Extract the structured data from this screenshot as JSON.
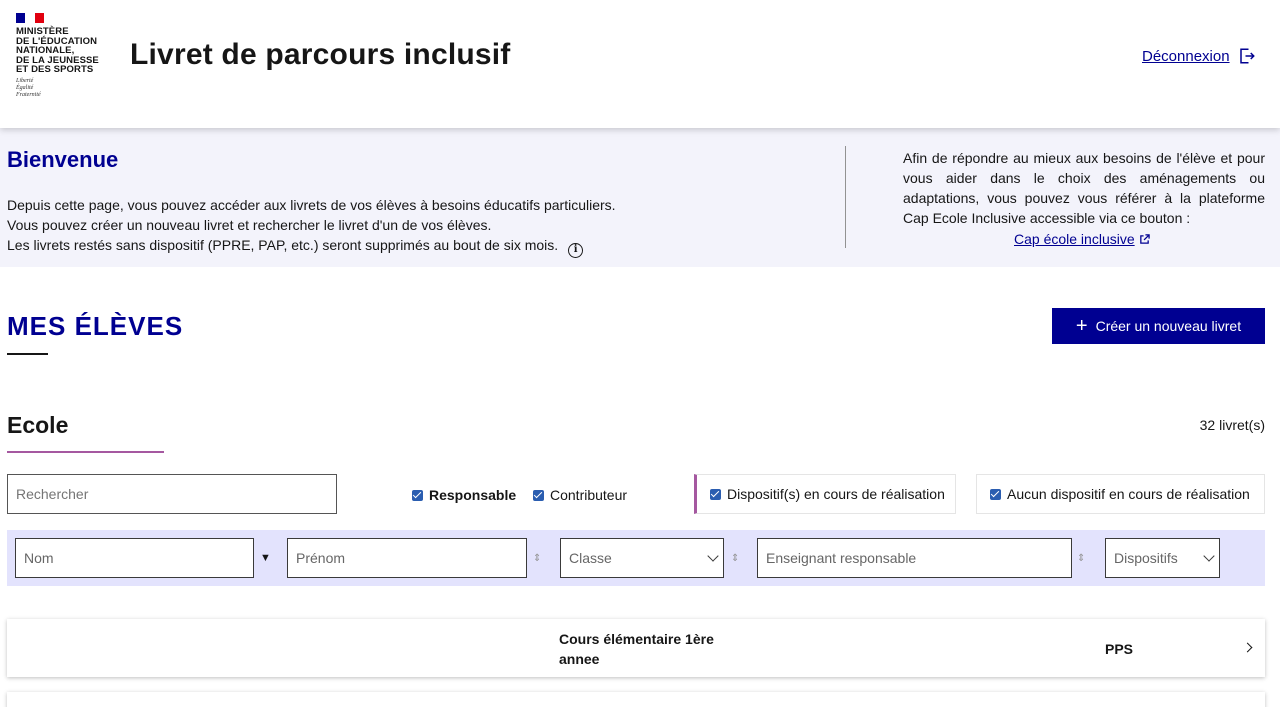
{
  "header": {
    "logo_lines": [
      "Ministère",
      "de l'Éducation",
      "nationale,",
      "de la Jeunesse",
      "et des Sports"
    ],
    "motto_lines": [
      "Liberté",
      "Égalité",
      "Fraternité"
    ],
    "title": "Livret de parcours inclusif",
    "logout_label": "Déconnexion"
  },
  "welcome": {
    "title": "Bienvenue",
    "line1": "Depuis cette page, vous pouvez accéder aux livrets de vos élèves à besoins éducatifs particuliers.",
    "line2": "Vous pouvez créer un nouveau livret et rechercher le livret d'un de vos élèves.",
    "line3": "Les livrets restés sans dispositif (PPRE, PAP, etc.) seront supprimés au bout de six mois.",
    "side_text": "Afin de répondre au mieux aux besoins de l'élève et pour vous aider dans le choix des aménagements ou adaptations, vous pouvez vous référer à la plateforme Cap Ecole Inclusive accessible via ce bouton :",
    "side_link": "Cap école inclusive"
  },
  "students": {
    "title": "MES ÉLÈVES",
    "create_label": "Créer un nouveau livret",
    "school_title": "Ecole",
    "count": "32 livret(s)"
  },
  "filters": {
    "search_placeholder": "Rechercher",
    "responsable": "Responsable",
    "contributeur": "Contributeur",
    "dispositif_en_cours": "Dispositif(s) en cours de réalisation",
    "aucun_dispositif": "Aucun dispositif en cours de réalisation"
  },
  "table": {
    "columns": {
      "nom": "Nom",
      "prenom": "Prénom",
      "classe": "Classe",
      "enseignant": "Enseignant responsable",
      "dispositifs": "Dispositifs"
    },
    "rows": [
      {
        "classe_line1": "Cours élémentaire 1ère",
        "classe_line2": "annee",
        "dispositif": "PPS"
      }
    ]
  },
  "colors": {
    "primary": "#000091",
    "accent": "#a558a0",
    "band": "#f3f3fb",
    "table_header": "#e3e3fd"
  }
}
